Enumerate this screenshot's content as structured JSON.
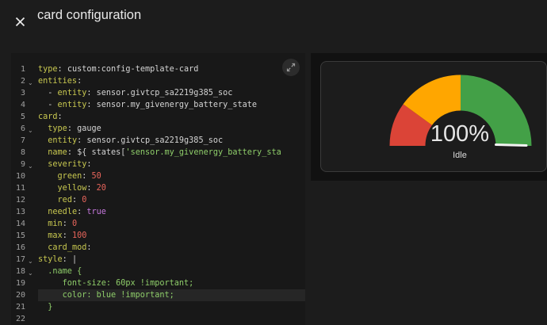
{
  "header": {
    "title": "card configuration"
  },
  "editor": {
    "active_line": 20,
    "fold_lines": [
      2,
      6,
      9,
      17,
      18
    ],
    "lines": [
      [
        {
          "t": "type",
          "c": "#c8c850"
        },
        {
          "t": ": ",
          "c": "#d4d4d4"
        },
        {
          "t": "custom:config-template-card",
          "c": "#d4d4d4"
        }
      ],
      [
        {
          "t": "entities",
          "c": "#c8c850"
        },
        {
          "t": ":",
          "c": "#d4d4d4"
        }
      ],
      [
        {
          "t": "  - ",
          "c": "#d4d4d4"
        },
        {
          "t": "entity",
          "c": "#c8c850"
        },
        {
          "t": ": ",
          "c": "#d4d4d4"
        },
        {
          "t": "sensor.givtcp_sa2219g385_soc",
          "c": "#d4d4d4"
        }
      ],
      [
        {
          "t": "  - ",
          "c": "#d4d4d4"
        },
        {
          "t": "entity",
          "c": "#c8c850"
        },
        {
          "t": ": ",
          "c": "#d4d4d4"
        },
        {
          "t": "sensor.my_givenergy_battery_state",
          "c": "#d4d4d4"
        }
      ],
      [
        {
          "t": "card",
          "c": "#c8c850"
        },
        {
          "t": ":",
          "c": "#d4d4d4"
        }
      ],
      [
        {
          "t": "  ",
          "c": "#d4d4d4"
        },
        {
          "t": "type",
          "c": "#c8c850"
        },
        {
          "t": ": ",
          "c": "#d4d4d4"
        },
        {
          "t": "gauge",
          "c": "#d4d4d4"
        }
      ],
      [
        {
          "t": "  ",
          "c": "#d4d4d4"
        },
        {
          "t": "entity",
          "c": "#c8c850"
        },
        {
          "t": ": ",
          "c": "#d4d4d4"
        },
        {
          "t": "sensor.givtcp_sa2219g385_soc",
          "c": "#d4d4d4"
        }
      ],
      [
        {
          "t": "  ",
          "c": "#d4d4d4"
        },
        {
          "t": "name",
          "c": "#c8c850"
        },
        {
          "t": ": ",
          "c": "#d4d4d4"
        },
        {
          "t": "${ states[",
          "c": "#d4d4d4"
        },
        {
          "t": "'sensor.my_givenergy_battery_sta",
          "c": "#8fce6a"
        }
      ],
      [
        {
          "t": "  ",
          "c": "#d4d4d4"
        },
        {
          "t": "severity",
          "c": "#c8c850"
        },
        {
          "t": ":",
          "c": "#d4d4d4"
        }
      ],
      [
        {
          "t": "    ",
          "c": "#d4d4d4"
        },
        {
          "t": "green",
          "c": "#c8c850"
        },
        {
          "t": ": ",
          "c": "#d4d4d4"
        },
        {
          "t": "50",
          "c": "#e8655b"
        }
      ],
      [
        {
          "t": "    ",
          "c": "#d4d4d4"
        },
        {
          "t": "yellow",
          "c": "#c8c850"
        },
        {
          "t": ": ",
          "c": "#d4d4d4"
        },
        {
          "t": "20",
          "c": "#e8655b"
        }
      ],
      [
        {
          "t": "    ",
          "c": "#d4d4d4"
        },
        {
          "t": "red",
          "c": "#c8c850"
        },
        {
          "t": ": ",
          "c": "#d4d4d4"
        },
        {
          "t": "0",
          "c": "#e8655b"
        }
      ],
      [
        {
          "t": "  ",
          "c": "#d4d4d4"
        },
        {
          "t": "needle",
          "c": "#c8c850"
        },
        {
          "t": ": ",
          "c": "#d4d4d4"
        },
        {
          "t": "true",
          "c": "#c678dd"
        }
      ],
      [
        {
          "t": "  ",
          "c": "#d4d4d4"
        },
        {
          "t": "min",
          "c": "#c8c850"
        },
        {
          "t": ": ",
          "c": "#d4d4d4"
        },
        {
          "t": "0",
          "c": "#e8655b"
        }
      ],
      [
        {
          "t": "  ",
          "c": "#d4d4d4"
        },
        {
          "t": "max",
          "c": "#c8c850"
        },
        {
          "t": ": ",
          "c": "#d4d4d4"
        },
        {
          "t": "100",
          "c": "#e8655b"
        }
      ],
      [
        {
          "t": "  ",
          "c": "#d4d4d4"
        },
        {
          "t": "card_mod",
          "c": "#c8c850"
        },
        {
          "t": ":",
          "c": "#d4d4d4"
        }
      ],
      [
        {
          "t": "style",
          "c": "#c8c850"
        },
        {
          "t": ": |",
          "c": "#d4d4d4"
        }
      ],
      [
        {
          "t": "  .name {",
          "c": "#8fce6a"
        }
      ],
      [
        {
          "t": "     font-size: 60px !important;",
          "c": "#8fce6a"
        }
      ],
      [
        {
          "t": "     color: blue !important;",
          "c": "#8fce6a"
        }
      ],
      [
        {
          "t": "  }",
          "c": "#8fce6a"
        }
      ],
      []
    ]
  },
  "gauge": {
    "value": 100,
    "min": 0,
    "max": 100,
    "value_text": "100%",
    "name": "Idle",
    "severity": {
      "red": 0,
      "yellow": 20,
      "green": 50
    },
    "colors": {
      "red": "#db4437",
      "yellow": "#ffa600",
      "green": "#43a047"
    }
  }
}
